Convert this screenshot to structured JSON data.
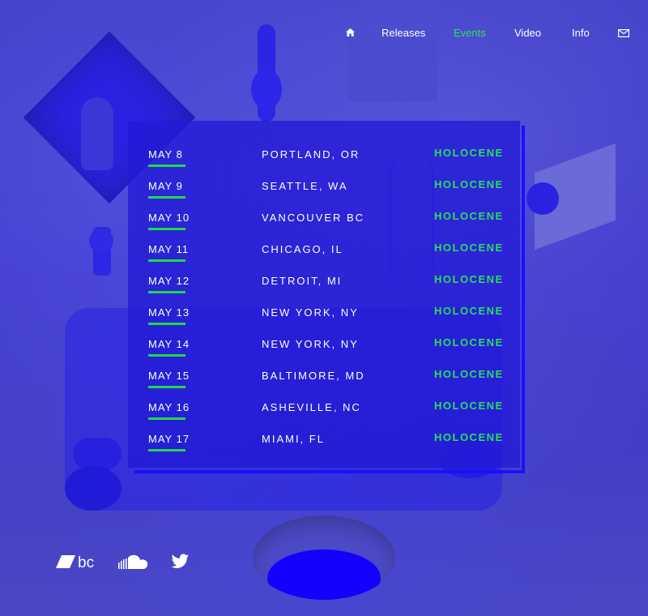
{
  "nav": {
    "home_icon": "home-icon",
    "items": [
      {
        "label": "Releases",
        "active": false
      },
      {
        "label": "Events",
        "active": true
      },
      {
        "label": "Video",
        "active": false
      },
      {
        "label": "Info",
        "active": false
      }
    ],
    "mail_icon": "mail-icon"
  },
  "events": [
    {
      "date": "MAY 8",
      "city": "PORTLAND, OR",
      "venue": "HOLOCENE"
    },
    {
      "date": "MAY 9",
      "city": "SEATTLE, WA",
      "venue": "HOLOCENE"
    },
    {
      "date": "MAY 10",
      "city": "VANCOUVER BC",
      "venue": "HOLOCENE"
    },
    {
      "date": "MAY 11",
      "city": "CHICAGO, IL",
      "venue": "HOLOCENE"
    },
    {
      "date": "MAY 12",
      "city": "DETROIT, MI",
      "venue": "HOLOCENE"
    },
    {
      "date": "MAY 13",
      "city": "NEW YORK, NY",
      "venue": "HOLOCENE"
    },
    {
      "date": "MAY 14",
      "city": "NEW YORK, NY",
      "venue": "HOLOCENE"
    },
    {
      "date": "MAY 15",
      "city": "BALTIMORE, MD",
      "venue": "HOLOCENE"
    },
    {
      "date": "MAY 16",
      "city": "ASHEVILLE, NC",
      "venue": "HOLOCENE"
    },
    {
      "date": "MAY 17",
      "city": "MIAMI, FL",
      "venue": "HOLOCENE"
    }
  ],
  "social": {
    "bandcamp_label": "bc",
    "icons": [
      "bandcamp-icon",
      "soundcloud-icon",
      "twitter-icon"
    ]
  },
  "colors": {
    "background": "#3a36c8",
    "panel": "#221ad6",
    "accent_green": "#26e05a",
    "text": "#ffffff"
  }
}
